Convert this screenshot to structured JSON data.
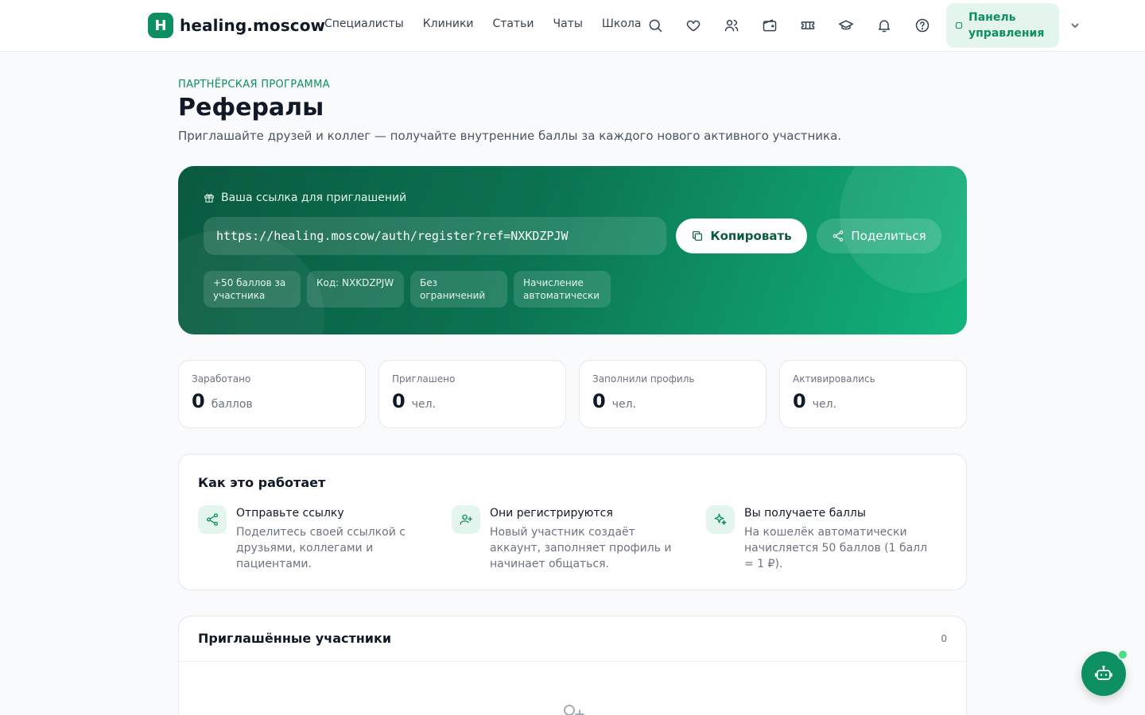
{
  "header": {
    "logo_letter": "H",
    "logo_text": "healing.moscow",
    "nav": [
      "Специалисты",
      "Клиники",
      "Статьи",
      "Чаты",
      "Школа"
    ],
    "icons": [
      "search-icon",
      "heart-icon",
      "users-icon",
      "wallet-icon",
      "ticket-icon",
      "graduation-cap-icon",
      "bell-icon",
      "help-icon"
    ],
    "panel_label": "Панель управления"
  },
  "page": {
    "eyebrow": "ПАРТНЁРСКАЯ ПРОГРАММА",
    "title": "Рефералы",
    "subtitle": "Приглашайте друзей и коллег — получайте внутренние баллы за каждого нового активного участника."
  },
  "hero": {
    "label": "Ваша ссылка для приглашений",
    "link": "https://healing.moscow/auth/register?ref=NXKDZPJW",
    "copy_label": "Копировать",
    "share_label": "Поделиться",
    "chips": [
      "+50 баллов за участника",
      "Код: NXKDZPJW",
      "Без ограничений",
      "Начисление автоматически"
    ]
  },
  "stats": [
    {
      "label": "Заработано",
      "value": "0",
      "unit": "баллов"
    },
    {
      "label": "Приглашено",
      "value": "0",
      "unit": "чел."
    },
    {
      "label": "Заполнили профиль",
      "value": "0",
      "unit": "чел."
    },
    {
      "label": "Активировались",
      "value": "0",
      "unit": "чел."
    }
  ],
  "how": {
    "title": "Как это работает",
    "steps": [
      {
        "icon": "share-icon",
        "title": "Отправьте ссылку",
        "desc": "Поделитесь своей ссылкой с друзьями, коллегами и пациентами."
      },
      {
        "icon": "user-plus-icon",
        "title": "Они регистрируются",
        "desc": "Новый участник создаёт аккаунт, заполняет профиль и начинает общаться."
      },
      {
        "icon": "sparkles-icon",
        "title": "Вы получаете баллы",
        "desc": "На кошелёк автоматически начисляется 50 баллов (1 балл = 1 ₽)."
      }
    ]
  },
  "invited": {
    "title": "Приглашённые участники",
    "count": "0"
  },
  "colors": {
    "brand": "#0d8f62",
    "hero_dark": "#0a5a40",
    "hero_light": "#12b57d"
  }
}
